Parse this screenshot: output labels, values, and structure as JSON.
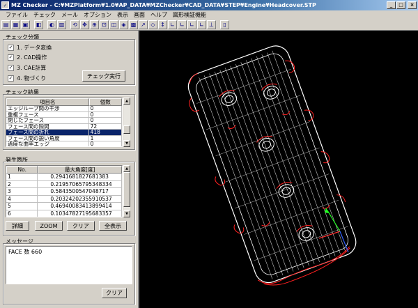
{
  "window": {
    "title": "MZ Checker - C:¥MZPlatform¥1.0¥AP_DATA¥MZChecker¥CAD_DATA¥STEP¥Engine¥Headcover.STP",
    "app_icon": "app-icon",
    "controls": [
      "_",
      "□",
      "×"
    ]
  },
  "menu": [
    "ファイル",
    "チェック",
    "メール",
    "オプション",
    "表示",
    "画面",
    "ヘルプ",
    "図形検証機能"
  ],
  "toolbar": {
    "icons": [
      "file-open-icon",
      "save-icon",
      "print-icon",
      "settings-icon",
      "import-icon",
      "export-icon",
      "rotate-icon",
      "pan-icon",
      "zoom-icon",
      "zoom-fit-icon",
      "view-front-icon",
      "view-iso-icon",
      "wireframe-icon",
      "measure-icon",
      "point-icon",
      "view-top-icon",
      "view-bottom-icon",
      "view-left-icon",
      "view-right-icon",
      "view-back-icon",
      "axis-icon",
      "layout-icon"
    ]
  },
  "check_category": {
    "title": "チェック分類",
    "items": [
      {
        "label": "1. データ変換",
        "checked": true
      },
      {
        "label": "2. CAD操作",
        "checked": true
      },
      {
        "label": "3. CAE計算",
        "checked": true
      },
      {
        "label": "4. 物づくり",
        "checked": true
      }
    ],
    "run_button": "チェック実行"
  },
  "check_results": {
    "title": "チェック結果",
    "columns": [
      "項目名",
      "個数"
    ],
    "rows": [
      {
        "name": "エッジループ間の干渉",
        "count": "0"
      },
      {
        "name": "重複フェース",
        "count": "0"
      },
      {
        "name": "閉じたフェース",
        "count": "0"
      },
      {
        "name": "フェース間の隙間",
        "count": "72"
      },
      {
        "name": "フェース間の折れ",
        "count": "418"
      },
      {
        "name": "フェース間の鋭い角度",
        "count": "1"
      },
      {
        "name": "過度な曲率エッジ",
        "count": "0"
      }
    ],
    "selected_index": 4
  },
  "occurrences": {
    "title": "発生箇所",
    "columns": [
      "No.",
      "最大角度[度]"
    ],
    "rows": [
      {
        "no": "1",
        "value": "0.2941681827681383"
      },
      {
        "no": "2",
        "value": "0.21957065795348334"
      },
      {
        "no": "3",
        "value": "0.5843500547048717"
      },
      {
        "no": "4",
        "value": "0.20324202355910537"
      },
      {
        "no": "5",
        "value": "0.46940083413899414"
      },
      {
        "no": "6",
        "value": "0.10347827195683357"
      }
    ],
    "buttons": [
      "詳細",
      "ZOOM",
      "クリア",
      "全表示"
    ]
  },
  "message": {
    "title": "メッセージ",
    "text": "FACE 数 660",
    "clear_button": "クリア"
  },
  "colors": {
    "title_start": "#0a246a",
    "title_end": "#a6caf0",
    "selection": "#0a246a",
    "viewport_bg": "#000000",
    "mesh": "#ffffff",
    "highlight": "#ff2020",
    "axis_x": "#ff3030",
    "axis_y": "#20ff20",
    "axis_z": "#3060ff"
  }
}
